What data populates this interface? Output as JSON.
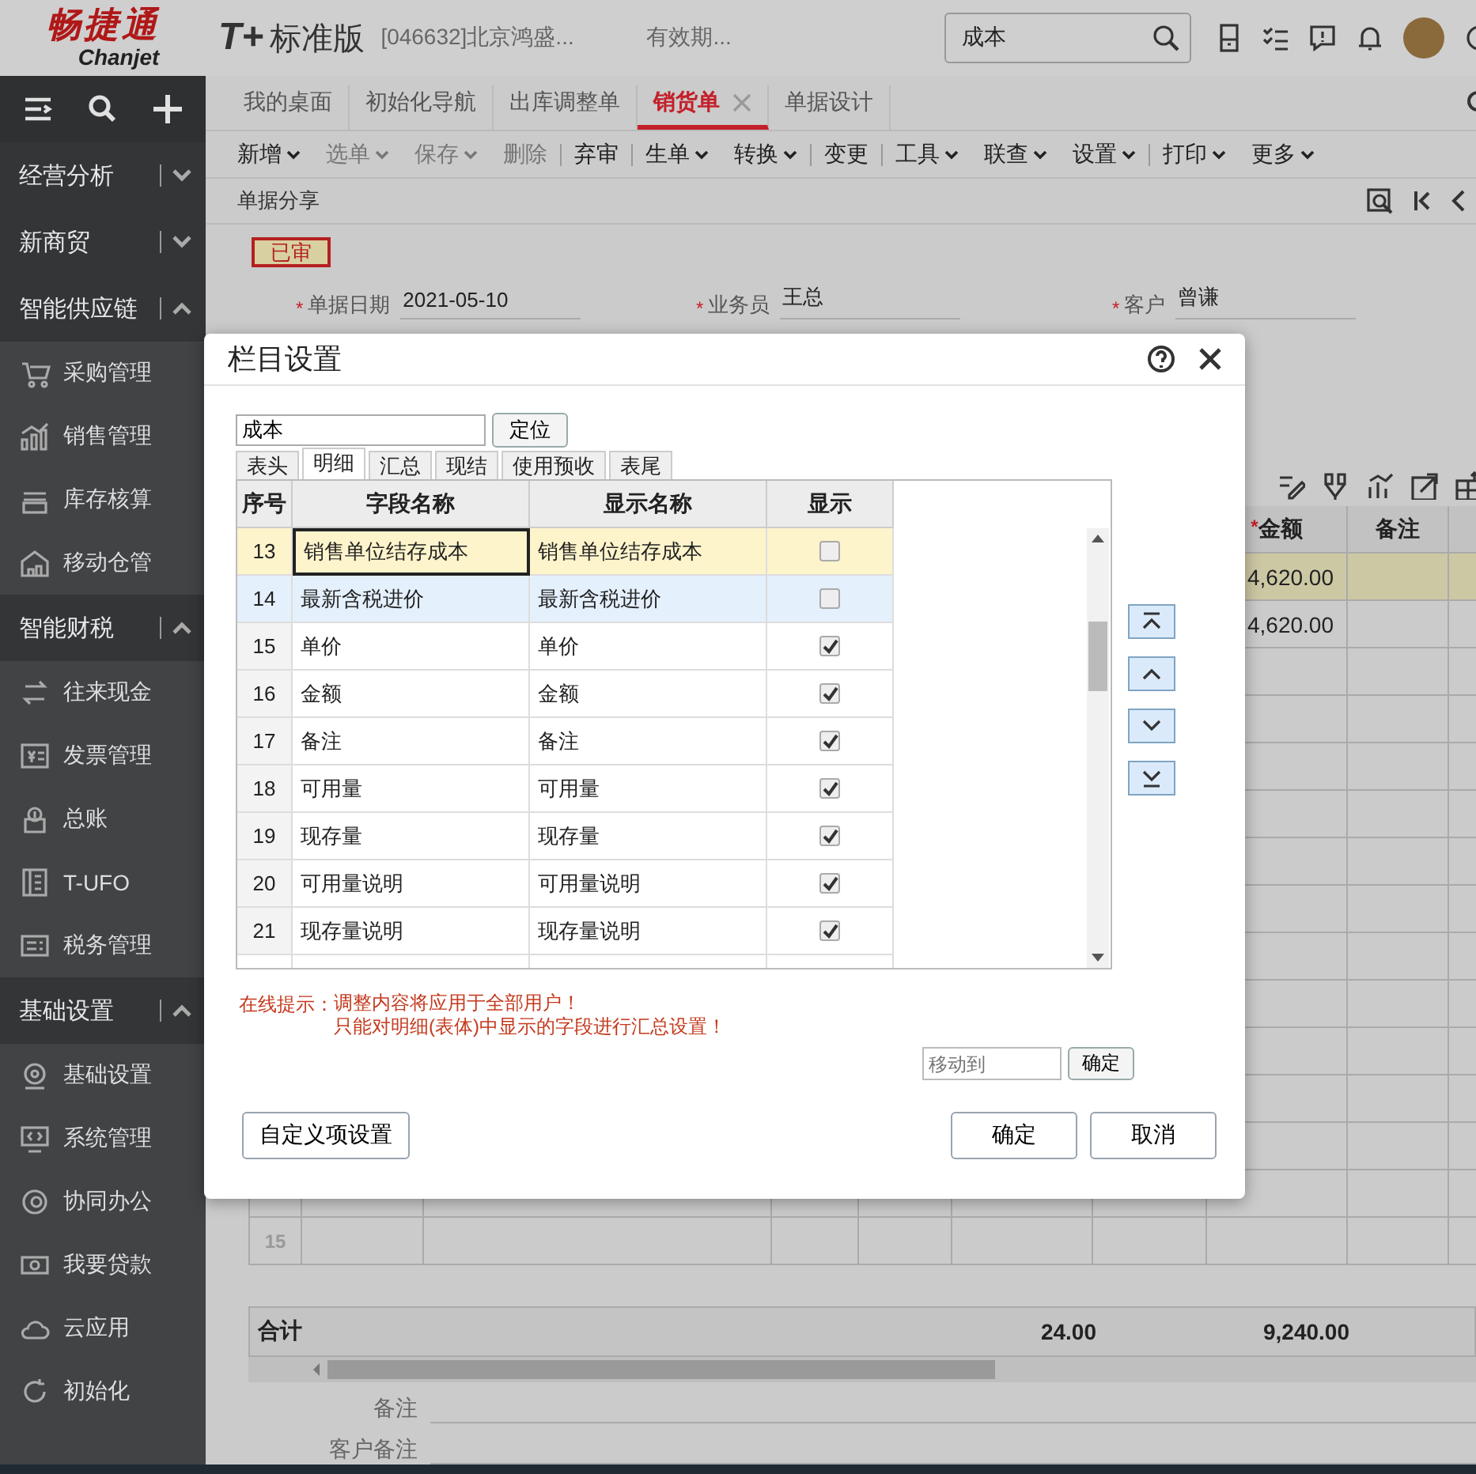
{
  "header": {
    "logo_cn": "畅捷通",
    "logo_en": "Chanjet",
    "product": "T+",
    "edition": "标准版",
    "company": "[046632]北京鸿盛...",
    "validity": "有效期...",
    "search": {
      "value": "成本"
    }
  },
  "sidebar": {
    "groups": [
      {
        "label": "经营分析",
        "expanded": false
      },
      {
        "label": "新商贸",
        "expanded": false
      },
      {
        "label": "智能供应链",
        "expanded": true,
        "items": [
          {
            "label": "采购管理"
          },
          {
            "label": "销售管理"
          },
          {
            "label": "库存核算"
          },
          {
            "label": "移动仓管"
          }
        ]
      },
      {
        "label": "智能财税",
        "expanded": true,
        "items": [
          {
            "label": "往来现金"
          },
          {
            "label": "发票管理"
          },
          {
            "label": "总账"
          },
          {
            "label": "T-UFO"
          },
          {
            "label": "税务管理"
          }
        ]
      },
      {
        "label": "基础设置",
        "expanded": true,
        "items": [
          {
            "label": "基础设置"
          },
          {
            "label": "系统管理"
          },
          {
            "label": "协同办公"
          },
          {
            "label": "我要贷款"
          },
          {
            "label": "云应用"
          },
          {
            "label": "初始化"
          }
        ]
      }
    ]
  },
  "tabs": [
    {
      "label": "我的桌面",
      "selected": false,
      "closable": false
    },
    {
      "label": "初始化导航",
      "selected": false,
      "closable": false
    },
    {
      "label": "出库调整单",
      "selected": false,
      "closable": false
    },
    {
      "label": "销货单",
      "selected": true,
      "closable": true
    },
    {
      "label": "单据设计",
      "selected": false,
      "closable": false
    }
  ],
  "toolbar": [
    {
      "label": "新增",
      "dropdown": true,
      "disabled": false,
      "separator_after": false
    },
    {
      "label": "选单",
      "dropdown": true,
      "disabled": true,
      "separator_after": false
    },
    {
      "label": "保存",
      "dropdown": true,
      "disabled": true,
      "separator_after": false
    },
    {
      "label": "删除",
      "dropdown": false,
      "disabled": true,
      "separator_after": true
    },
    {
      "label": "弃审",
      "dropdown": false,
      "disabled": false,
      "separator_after": true
    },
    {
      "label": "生单",
      "dropdown": true,
      "disabled": false,
      "separator_after": false
    },
    {
      "label": "转换",
      "dropdown": true,
      "disabled": false,
      "separator_after": true
    },
    {
      "label": "变更",
      "dropdown": false,
      "disabled": false,
      "separator_after": true
    },
    {
      "label": "工具",
      "dropdown": true,
      "disabled": false,
      "separator_after": false
    },
    {
      "label": "联查",
      "dropdown": true,
      "disabled": false,
      "separator_after": false
    },
    {
      "label": "设置",
      "dropdown": true,
      "disabled": false,
      "separator_after": true
    },
    {
      "label": "打印",
      "dropdown": true,
      "disabled": false,
      "separator_after": false
    },
    {
      "label": "更多",
      "dropdown": true,
      "disabled": false,
      "separator_after": false
    }
  ],
  "share_label": "单据分享",
  "status_badge": "已审",
  "fields": [
    {
      "marker": "*",
      "label": "单据日期",
      "value": "2021-05-10"
    },
    {
      "marker": "*",
      "label": "业务员",
      "value": "王总"
    },
    {
      "marker": "*",
      "label": "客户",
      "value": "曾谦"
    }
  ],
  "grid": {
    "columns": [
      {
        "marker": "*",
        "label": "金额"
      },
      {
        "label": "备注"
      }
    ],
    "rows": [
      {
        "amount": "4,620.00",
        "selected": true
      },
      {
        "amount": "4,620.00",
        "selected": false
      }
    ],
    "last_row_number": "15",
    "total": {
      "label": "合计",
      "quantity": "24.00",
      "amount": "9,240.00"
    }
  },
  "notes": [
    {
      "label": "备注"
    },
    {
      "label": "客户备注"
    }
  ],
  "dialog": {
    "title": "栏目设置",
    "search": {
      "value": "成本"
    },
    "locate_button": "定位",
    "tabs": [
      {
        "label": "表头",
        "selected": false
      },
      {
        "label": "明细",
        "selected": true
      },
      {
        "label": "汇总",
        "selected": false
      },
      {
        "label": "现结",
        "selected": false
      },
      {
        "label": "使用预收",
        "selected": false
      },
      {
        "label": "表尾",
        "selected": false
      }
    ],
    "columns": [
      "序号",
      "字段名称",
      "显示名称",
      "显示"
    ],
    "rows": [
      {
        "no": "13",
        "field": "销售单位结存成本",
        "display": "销售单位结存成本",
        "shown": false,
        "selected": true,
        "hover": false
      },
      {
        "no": "14",
        "field": "最新含税进价",
        "display": "最新含税进价",
        "shown": false,
        "selected": false,
        "hover": true
      },
      {
        "no": "15",
        "field": "单价",
        "display": "单价",
        "shown": true,
        "selected": false,
        "hover": false
      },
      {
        "no": "16",
        "field": "金额",
        "display": "金额",
        "shown": true,
        "selected": false,
        "hover": false
      },
      {
        "no": "17",
        "field": "备注",
        "display": "备注",
        "shown": true,
        "selected": false,
        "hover": false
      },
      {
        "no": "18",
        "field": "可用量",
        "display": "可用量",
        "shown": true,
        "selected": false,
        "hover": false
      },
      {
        "no": "19",
        "field": "现存量",
        "display": "现存量",
        "shown": true,
        "selected": false,
        "hover": false
      },
      {
        "no": "20",
        "field": "可用量说明",
        "display": "可用量说明",
        "shown": true,
        "selected": false,
        "hover": false
      },
      {
        "no": "21",
        "field": "现存量说明",
        "display": "现存量说明",
        "shown": true,
        "selected": false,
        "hover": false
      }
    ],
    "tip_label": "在线提示：",
    "tips": [
      "调整内容将应用于全部用户！",
      "只能对明细(表体)中显示的字段进行汇总设置！"
    ],
    "move_to": {
      "placeholder": "移动到"
    },
    "move_confirm": "确定",
    "custom_button": "自定义项设置",
    "ok_button": "确定",
    "cancel_button": "取消"
  }
}
